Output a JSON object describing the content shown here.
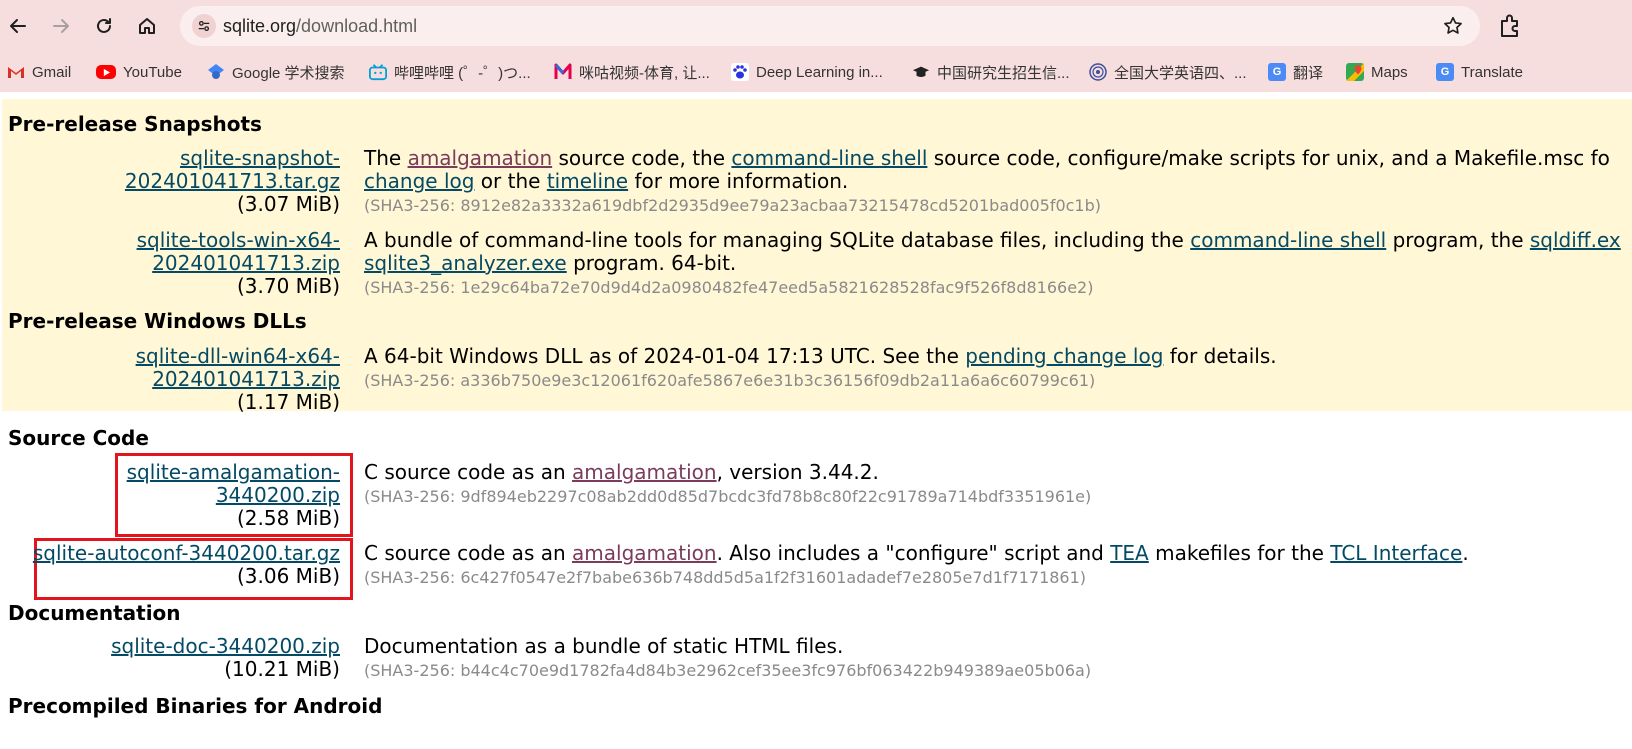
{
  "browser": {
    "url_host": "sqlite.org",
    "url_path": "/download.html",
    "bookmarks": [
      {
        "label": "Gmail",
        "icon": "gmail-icon"
      },
      {
        "label": "YouTube",
        "icon": "youtube-icon"
      },
      {
        "label": "Google 学术搜索",
        "icon": "google-scholar-icon"
      },
      {
        "label": "哔哩哔哩 (゜-゜)つ...",
        "icon": "bilibili-icon"
      },
      {
        "label": "咪咕视频-体育, 让...",
        "icon": "migu-icon"
      },
      {
        "label": "Deep Learning in...",
        "icon": "baidu-paw-icon"
      },
      {
        "label": "中国研究生招生信...",
        "icon": "graduation-cap-icon"
      },
      {
        "label": "全国大学英语四、...",
        "icon": "cet-seal-icon"
      },
      {
        "label": "翻译",
        "icon": "translate-icon"
      },
      {
        "label": "Maps",
        "icon": "maps-icon"
      },
      {
        "label": "Translate",
        "icon": "translate-icon"
      }
    ]
  },
  "page": {
    "sections": {
      "prerelease": "Pre-release Snapshots",
      "windows_dlls": "Pre-release Windows DLLs",
      "source_code": "Source Code",
      "documentation": "Documentation",
      "android": "Precompiled Binaries for Android"
    },
    "downloads": {
      "snapshot": {
        "link1": "sqlite-snapshot-",
        "link2": "202401041713.tar.gz",
        "size": "(3.07 MiB)",
        "desc1a": "The ",
        "desc1_amalgamation": "amalgamation",
        "desc1b": " source code, the ",
        "desc1_shell": "command-line shell",
        "desc1c": " source code, configure/make scripts for unix, and a Makefile.msc fo",
        "desc2_changelog": "change log",
        "desc2a": " or the ",
        "desc2_timeline": "timeline",
        "desc2b": " for more information.",
        "sha": "(SHA3-256: 8912e82a3332a619dbf2d2935d9ee79a23acbaa73215478cd5201bad005f0c1b)"
      },
      "tools": {
        "link1": "sqlite-tools-win-x64-",
        "link2": "202401041713.zip",
        "size": "(3.70 MiB)",
        "desc1a": "A bundle of command-line tools for managing SQLite database files, including the ",
        "desc1_shell": "command-line shell",
        "desc1b": " program, the ",
        "desc1_sqldiff": "sqldiff.ex",
        "desc2_analyzer": "sqlite3_analyzer.exe",
        "desc2a": " program. 64-bit.",
        "sha": "(SHA3-256: 1e29c64ba72e70d9d4d2a0980482fe47eed5a5821628528fac9f526f8d8166e2)"
      },
      "dll": {
        "link1": "sqlite-dll-win64-x64-",
        "link2": "202401041713.zip",
        "size": "(1.17 MiB)",
        "desc1a": "A 64-bit Windows DLL as of 2024-01-04 17:13 UTC. See the ",
        "desc1_pending": "pending change log",
        "desc1b": " for details.",
        "sha": "(SHA3-256: a336b750e9e3c12061f620afe5867e6e31b3c36156f09db2a11a6a6c60799c61)"
      },
      "amalgamation": {
        "link1": "sqlite-amalgamation-",
        "link2": "3440200.zip",
        "size": "(2.58 MiB)",
        "desc1a": "C source code as an ",
        "desc1_amalgamation": "amalgamation",
        "desc1b": ", version 3.44.2.",
        "sha": "(SHA3-256: 9df894eb2297c08ab2dd0d85d7bcdc3fd78b8c80f22c91789a714bdf3351961e)"
      },
      "autoconf": {
        "link1": "sqlite-autoconf-3440200.tar.gz",
        "size": "(3.06 MiB)",
        "desc1a": "C source code as an ",
        "desc1_amalgamation": "amalgamation",
        "desc1b": ". Also includes a \"configure\" script and ",
        "desc1_tea": "TEA",
        "desc1c": " makefiles for the ",
        "desc1_tcl": "TCL Interface",
        "desc1d": ".",
        "sha": "(SHA3-256: 6c427f0547e2f7babe636b748dd5d5a1f2f31601adadef7e2805e7d1f7171861)"
      },
      "doc": {
        "link1": "sqlite-doc-3440200.zip",
        "size": "(10.21 MiB)",
        "desc1a": "Documentation as a bundle of static HTML files.",
        "sha": "(SHA3-256: b44c4c70e9d1782fa4d84b3e2962cef35ee3fc976bf063422b949389ae05b06a)"
      }
    }
  }
}
